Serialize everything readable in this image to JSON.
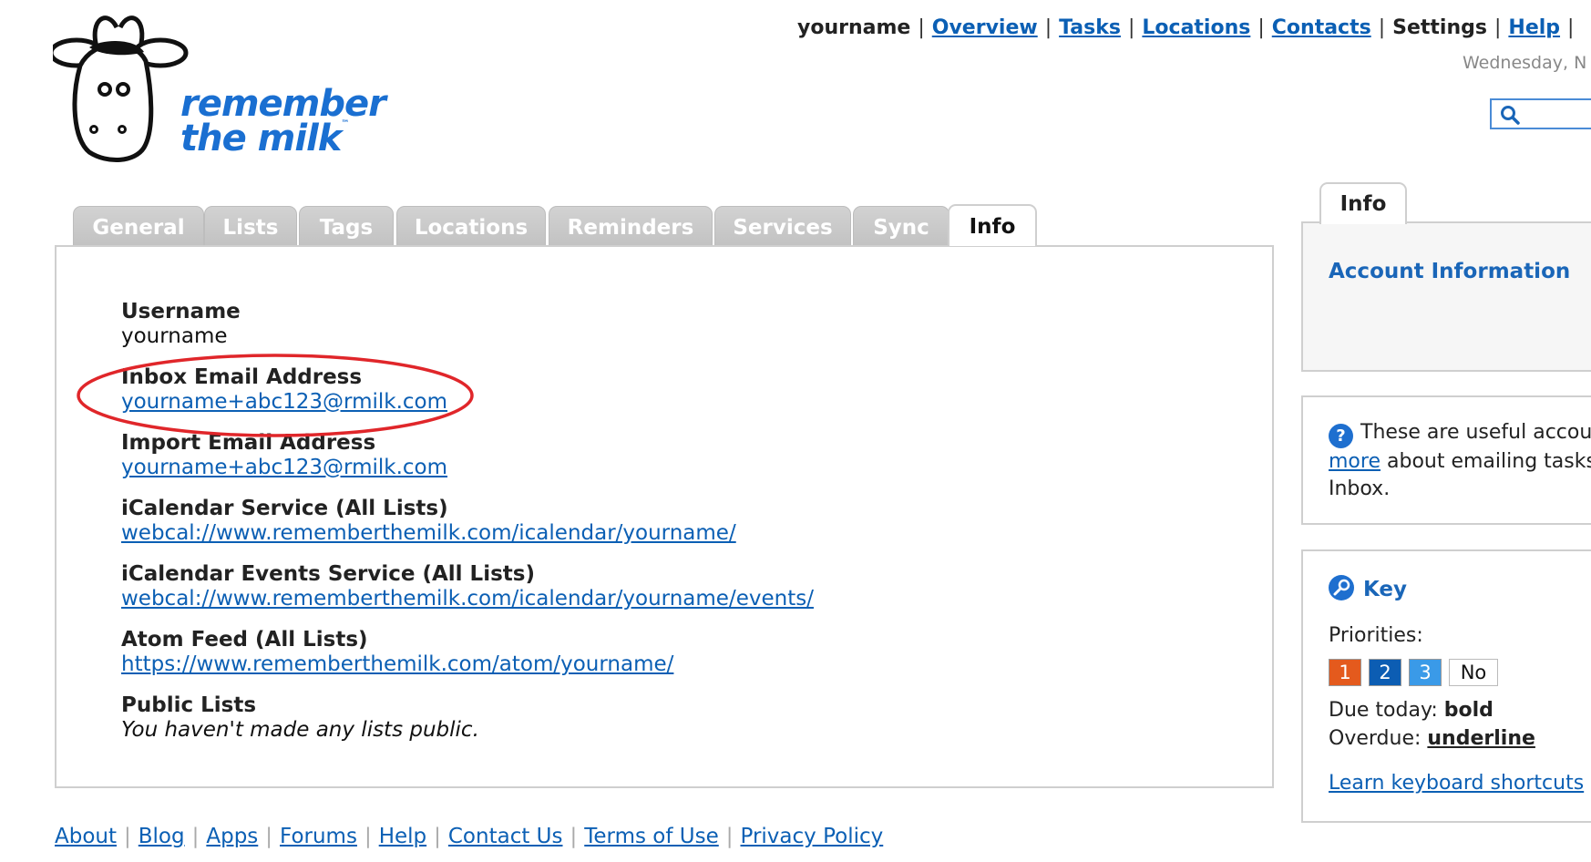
{
  "brand": {
    "line1": "remember",
    "line2": "the milk",
    "tm": "™"
  },
  "topnav": {
    "username": "yourname",
    "links": [
      "Overview",
      "Tasks",
      "Locations",
      "Contacts"
    ],
    "current": "Settings",
    "help": "Help",
    "date": "Wednesday, N"
  },
  "search": {
    "placeholder": "",
    "icon": "search-icon"
  },
  "tabs": [
    {
      "label": "General",
      "active": false
    },
    {
      "label": "Lists",
      "active": false
    },
    {
      "label": "Tags",
      "active": false
    },
    {
      "label": "Locations",
      "active": false
    },
    {
      "label": "Reminders",
      "active": false
    },
    {
      "label": "Services",
      "active": false
    },
    {
      "label": "Sync",
      "active": false
    },
    {
      "label": "Info",
      "active": true
    }
  ],
  "info": {
    "username_label": "Username",
    "username_value": "yourname",
    "inbox_label": "Inbox Email Address",
    "inbox_value": "yourname+abc123@rmilk.com",
    "import_label": "Import Email Address",
    "import_value": "yourname+abc123@rmilk.com",
    "ical_label": "iCalendar Service (All Lists)",
    "ical_value": "webcal://www.rememberthemilk.com/icalendar/yourname/",
    "ical_events_label": "iCalendar Events Service (All Lists)",
    "ical_events_value": "webcal://www.rememberthemilk.com/icalendar/yourname/events/",
    "atom_label": "Atom Feed (All Lists)",
    "atom_value": "https://www.rememberthemilk.com/atom/yourname/",
    "public_label": "Public Lists",
    "public_value": "You haven't made any lists public."
  },
  "sidebar": {
    "tab_label": "Info",
    "account_link": "Account Information",
    "help_text_1": "These are useful accou",
    "help_link": "more",
    "help_text_2": " about emailing tasks",
    "help_text_3": "Inbox.",
    "key_title": "Key",
    "priorities_label": "Priorities:",
    "priorities": [
      "1",
      "2",
      "3",
      "No"
    ],
    "priority_colors": [
      "#e45a1d",
      "#0c5db3",
      "#3a9ae8",
      "#ffffff"
    ],
    "due_label": "Due today: ",
    "due_value": "bold",
    "overdue_label": "Overdue: ",
    "overdue_value": "underline",
    "shortcuts_link": "Learn keyboard shortcuts"
  },
  "footer": {
    "links": [
      "About",
      "Blog",
      "Apps",
      "Forums",
      "Help",
      "Contact Us",
      "Terms of Use",
      "Privacy Policy"
    ]
  },
  "colors": {
    "link": "#0b5fb4",
    "highlight_oval": "#e0262a"
  }
}
